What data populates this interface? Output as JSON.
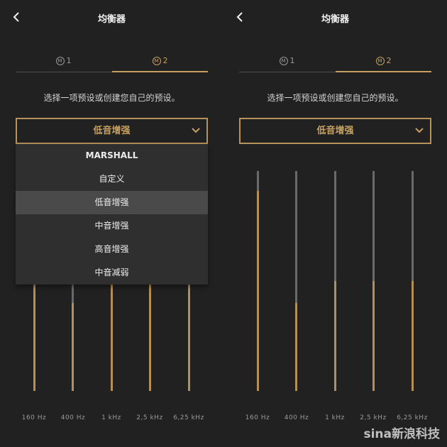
{
  "screens": {
    "left": {
      "title": "均衡器",
      "tabs": [
        {
          "label": "1",
          "active": false
        },
        {
          "label": "2",
          "active": true
        }
      ],
      "instruction": "选择一项预设或创建您自己的预设。",
      "selected_preset": "低音增强",
      "dropdown_open": true,
      "dropdown_options": [
        "MARSHALL",
        "自定义",
        "低音增强",
        "中音增强",
        "高音增强",
        "中音减弱"
      ],
      "selected_option_index": 2,
      "eq_labels": [
        "160 Hz",
        "400 Hz",
        "1 kHz",
        "2,5 kHz",
        "6,25 kHz"
      ]
    },
    "right": {
      "title": "均衡器",
      "tabs": [
        {
          "label": "1",
          "active": false
        },
        {
          "label": "2",
          "active": true
        }
      ],
      "instruction": "选择一项预设或创建您自己的预设。",
      "selected_preset": "低音增强",
      "dropdown_open": false,
      "eq_levels": [
        0.91,
        0.4,
        0.5,
        0.5,
        0.5
      ],
      "eq_labels": [
        "160 Hz",
        "400 Hz",
        "1 kHz",
        "2,5 kHz",
        "6,25 kHz"
      ]
    }
  },
  "eq_levels": [
    0.91,
    0.4,
    0.5,
    0.5,
    0.5
  ],
  "watermark": "sina新浪科技",
  "colors": {
    "background": "#212121",
    "accent": "#c6a062",
    "track": "#6a6a6a",
    "fill": "#b48f57"
  },
  "icons": {
    "back": "chevron-left-icon",
    "tab_logo": "marshall-m-icon",
    "dropdown": "chevron-down-icon"
  }
}
